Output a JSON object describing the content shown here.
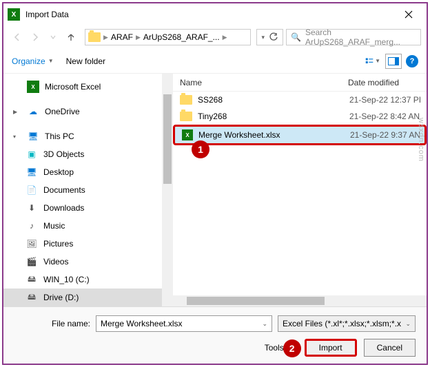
{
  "title": "Import Data",
  "breadcrumb": {
    "p1": "ARAF",
    "p2": "ArUpS268_ARAF_..."
  },
  "search": {
    "placeholder": "Search ArUpS268_ARAF_merg..."
  },
  "toolbar": {
    "organize": "Organize",
    "newfolder": "New folder"
  },
  "columns": {
    "name": "Name",
    "date": "Date modified"
  },
  "nav": {
    "excel": "Microsoft Excel",
    "onedrive": "OneDrive",
    "thispc": "This PC",
    "objects3d": "3D Objects",
    "desktop": "Desktop",
    "documents": "Documents",
    "downloads": "Downloads",
    "music": "Music",
    "pictures": "Pictures",
    "videos": "Videos",
    "win10": "WIN_10 (C:)",
    "drived": "Drive (D:)"
  },
  "items": [
    {
      "name": "SS268",
      "date": "21-Sep-22 12:37 PI"
    },
    {
      "name": "Tiny268",
      "date": "21-Sep-22 8:42 AN"
    },
    {
      "name": "Merge Worksheet.xlsx",
      "date": "21-Sep-22 9:37 AN"
    }
  ],
  "bottom": {
    "filename_label": "File name:",
    "filename_value": "Merge Worksheet.xlsx",
    "filter": "Excel Files (*.xl*;*.xlsx;*.xlsm;*.x",
    "tools": "Tools",
    "import": "Import",
    "cancel": "Cancel"
  },
  "callouts": {
    "one": "1",
    "two": "2"
  },
  "watermark": "wsxdn.com"
}
